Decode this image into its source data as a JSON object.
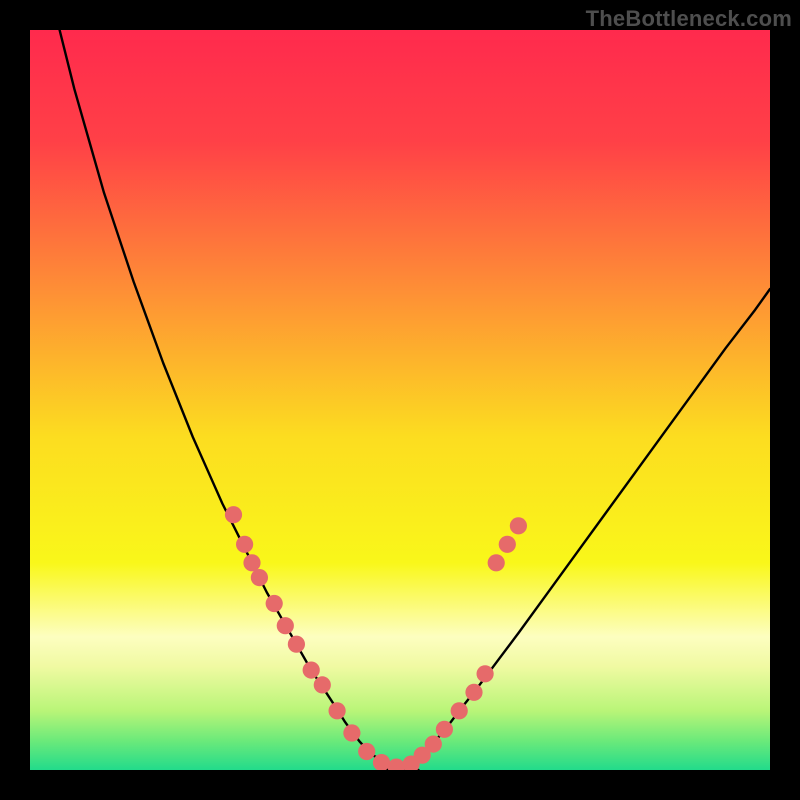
{
  "watermark": "TheBottleneck.com",
  "chart_data": {
    "type": "line",
    "title": "",
    "xlabel": "",
    "ylabel": "",
    "xlim": [
      0,
      100
    ],
    "ylim": [
      0,
      100
    ],
    "background_gradient_stops": [
      {
        "offset": 0.0,
        "color": "#ff2a4d"
      },
      {
        "offset": 0.15,
        "color": "#ff4047"
      },
      {
        "offset": 0.35,
        "color": "#fe8e36"
      },
      {
        "offset": 0.55,
        "color": "#fcdd20"
      },
      {
        "offset": 0.72,
        "color": "#f9f71a"
      },
      {
        "offset": 0.82,
        "color": "#fdfec0"
      },
      {
        "offset": 0.86,
        "color": "#f0faa2"
      },
      {
        "offset": 0.92,
        "color": "#b9f578"
      },
      {
        "offset": 0.96,
        "color": "#6cea7a"
      },
      {
        "offset": 1.0,
        "color": "#22db8b"
      }
    ],
    "series": [
      {
        "name": "left-curve",
        "x": [
          4,
          6,
          8,
          10,
          12,
          14,
          16,
          18,
          20,
          22,
          24,
          26,
          28,
          30,
          32,
          34,
          36,
          38,
          40,
          41.5,
          42.5,
          43.5,
          44.5,
          45.5,
          46.5,
          48.5,
          50.5,
          52.5
        ],
        "y": [
          100,
          92,
          85,
          78,
          72,
          66,
          60.5,
          55,
          50,
          45,
          40.5,
          36,
          32,
          28,
          24,
          20.5,
          17,
          13.5,
          10.5,
          8.2,
          6.6,
          5.2,
          3.9,
          2.8,
          1.9,
          0.8,
          0.2,
          0.0
        ]
      },
      {
        "name": "right-curve",
        "x": [
          47.5,
          49.5,
          51.5,
          53.5,
          55.0,
          56.5,
          58.0,
          60.0,
          63.0,
          66.0,
          70.0,
          74.0,
          78.0,
          82.0,
          86.0,
          90.0,
          94.0,
          98.0,
          100.0
        ],
        "y": [
          0.0,
          0.3,
          1.2,
          2.6,
          4.2,
          6.0,
          8.0,
          10.5,
          14.5,
          18.5,
          24.0,
          29.5,
          35.0,
          40.5,
          46.0,
          51.5,
          57.0,
          62.2,
          65.0
        ]
      }
    ],
    "markers": [
      {
        "x": 27.5,
        "y": 34.5
      },
      {
        "x": 29.0,
        "y": 30.5
      },
      {
        "x": 30.0,
        "y": 28.0
      },
      {
        "x": 31.0,
        "y": 26.0
      },
      {
        "x": 33.0,
        "y": 22.5
      },
      {
        "x": 34.5,
        "y": 19.5
      },
      {
        "x": 36.0,
        "y": 17.0
      },
      {
        "x": 38.0,
        "y": 13.5
      },
      {
        "x": 39.5,
        "y": 11.5
      },
      {
        "x": 41.5,
        "y": 8.0
      },
      {
        "x": 43.5,
        "y": 5.0
      },
      {
        "x": 45.5,
        "y": 2.5
      },
      {
        "x": 47.5,
        "y": 1.0
      },
      {
        "x": 49.5,
        "y": 0.4
      },
      {
        "x": 51.5,
        "y": 0.8
      },
      {
        "x": 53.0,
        "y": 2.0
      },
      {
        "x": 54.5,
        "y": 3.5
      },
      {
        "x": 56.0,
        "y": 5.5
      },
      {
        "x": 58.0,
        "y": 8.0
      },
      {
        "x": 60.0,
        "y": 10.5
      },
      {
        "x": 61.5,
        "y": 13.0
      },
      {
        "x": 63.0,
        "y": 28.0
      },
      {
        "x": 64.5,
        "y": 30.5
      },
      {
        "x": 66.0,
        "y": 33.0
      }
    ],
    "marker_color": "#e66a6a",
    "curve_color": "#000000"
  }
}
